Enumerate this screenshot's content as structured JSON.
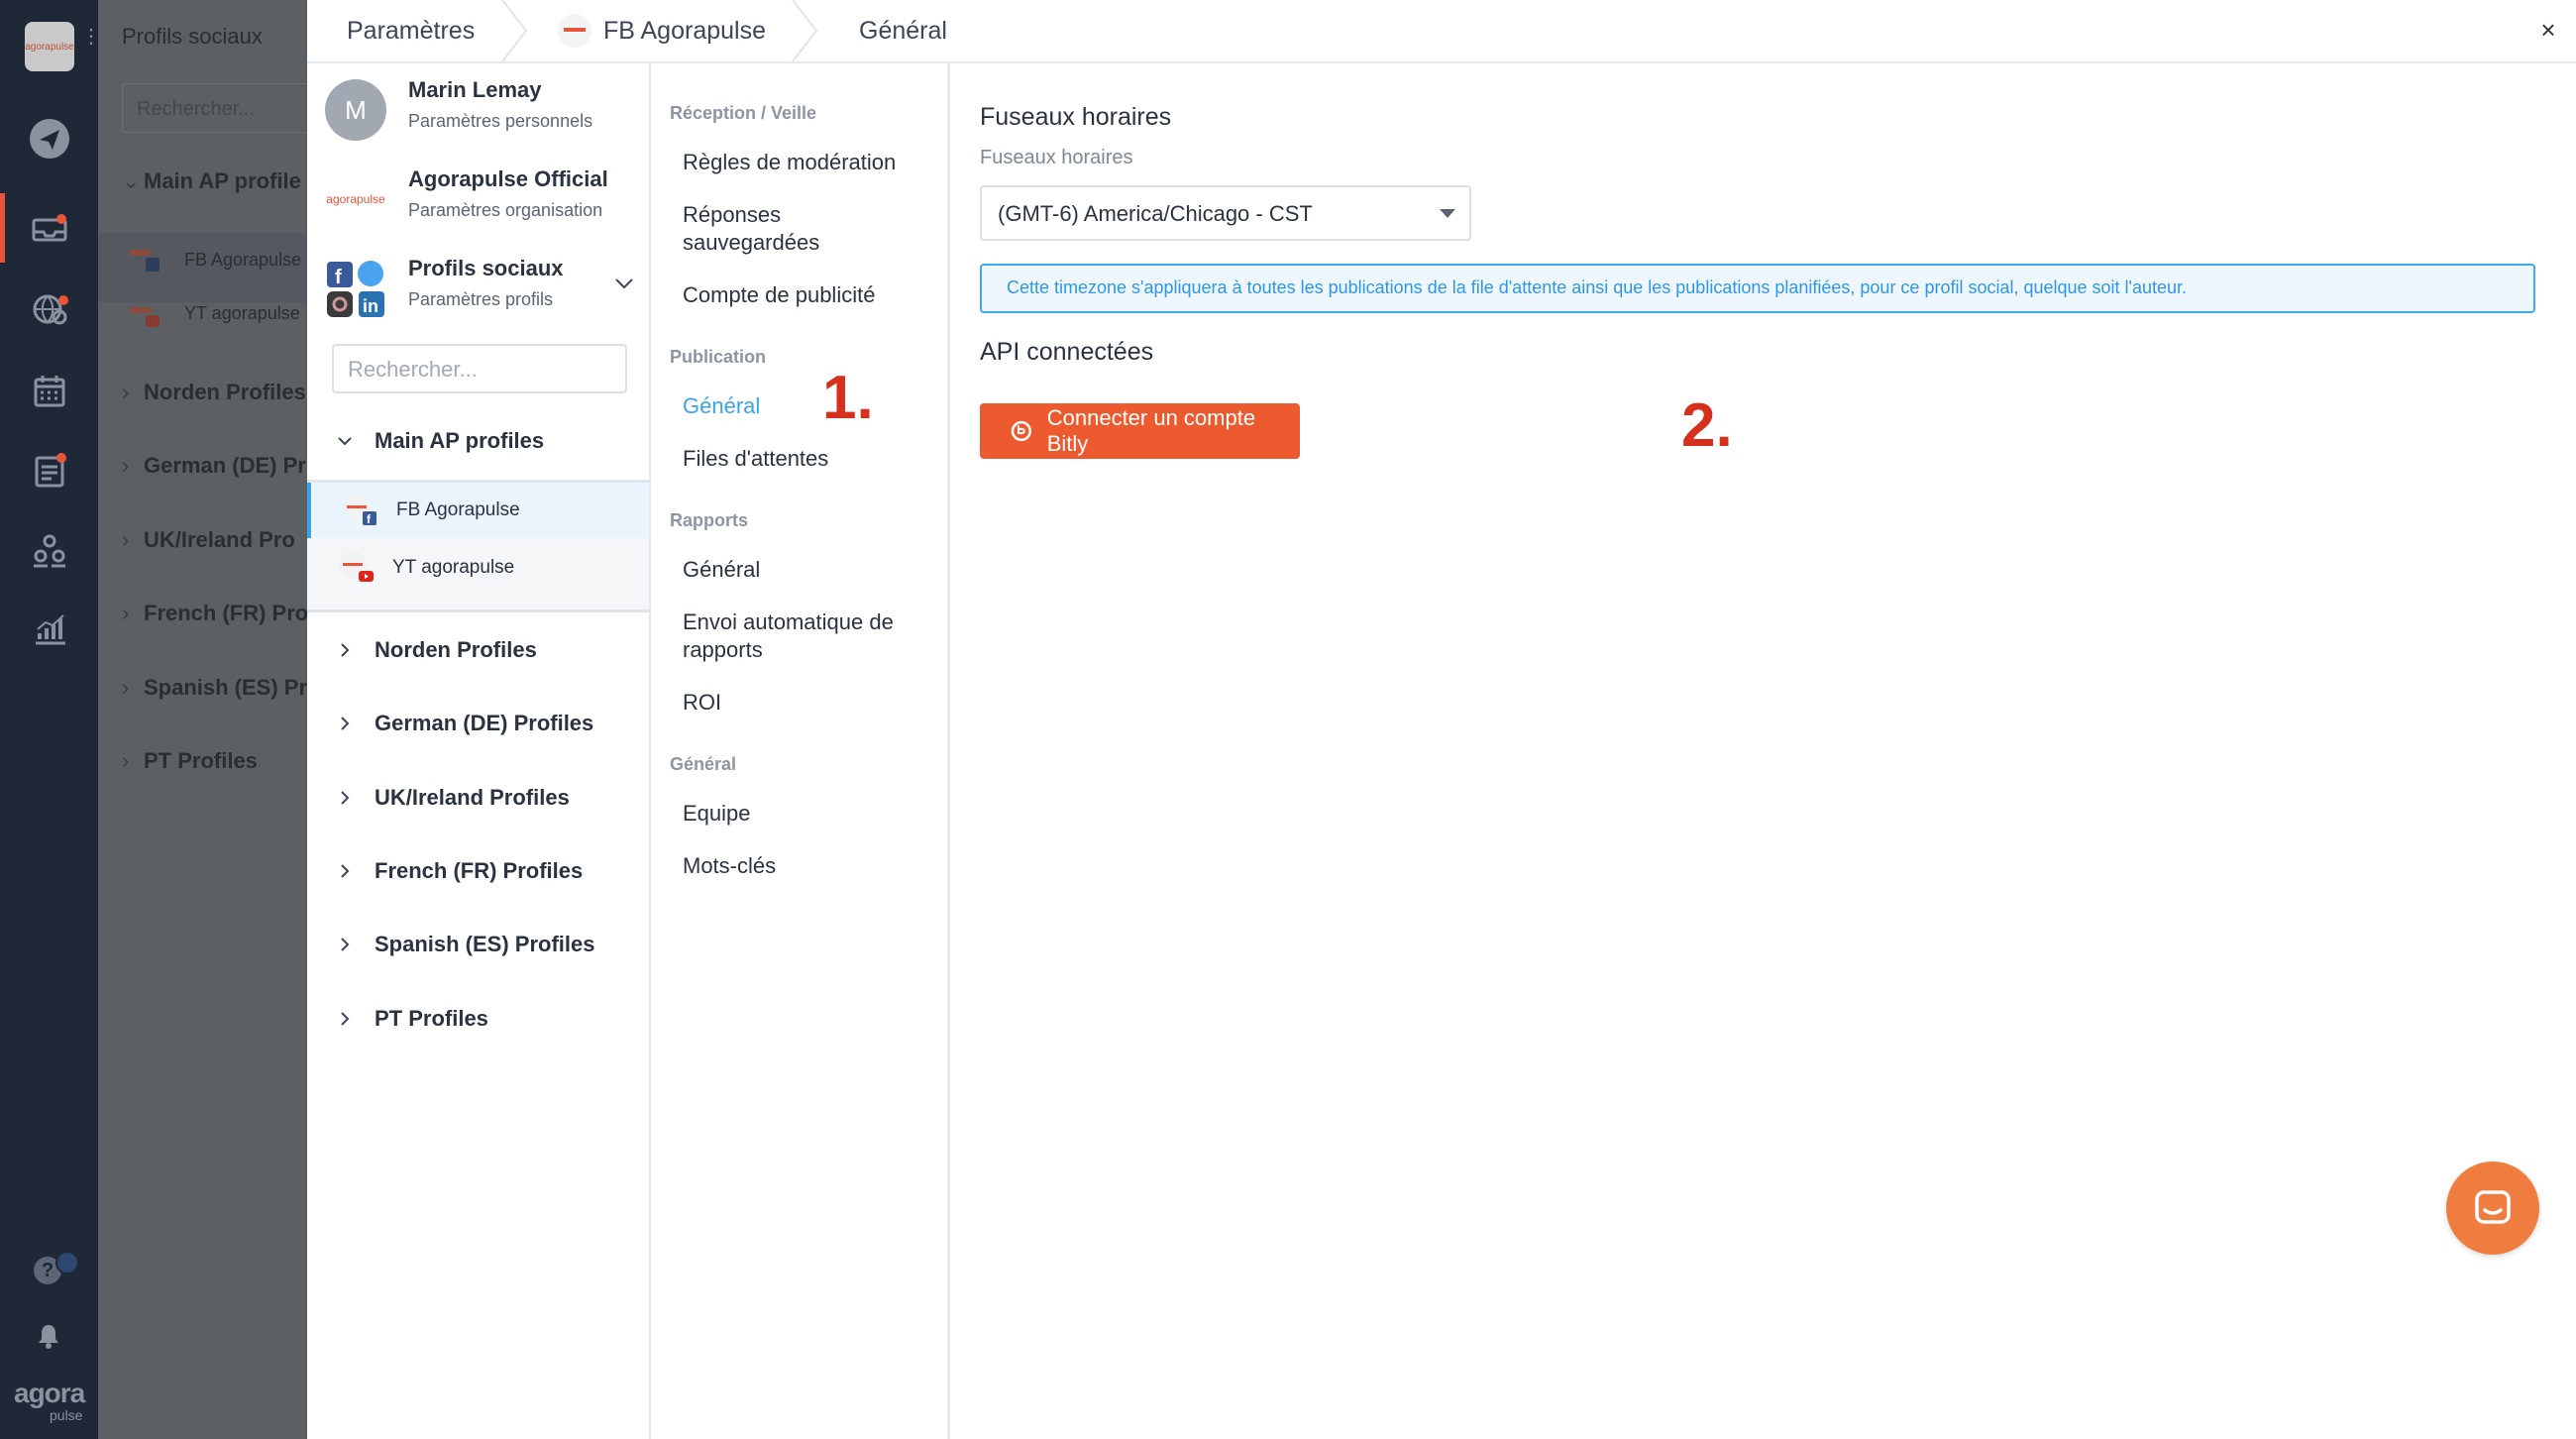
{
  "rail": {
    "logo_text": "agorapulse",
    "icons": [
      "send-icon",
      "inbox-icon",
      "listening-icon",
      "calendar-icon",
      "reports-icon",
      "team-icon",
      "analytics-icon"
    ],
    "brand": "agora",
    "brand_sub": "pulse"
  },
  "background_panel": {
    "title": "Profils sociaux",
    "search_placeholder": "Rechercher...",
    "groups": [
      "Main AP profile",
      "Norden Profiles",
      "German (DE) Pr",
      "UK/Ireland Pro",
      "French (FR) Pro",
      "Spanish (ES) Pr",
      "PT Profiles"
    ],
    "profiles": [
      "FB Agorapulse",
      "YT agorapulse"
    ]
  },
  "header": {
    "crumb1": "Paramètres",
    "crumb2": "FB Agorapulse",
    "crumb3": "Général",
    "close": "×"
  },
  "accounts": [
    {
      "initial": "M",
      "name": "Marin Lemay",
      "desc": "Paramètres personnels"
    },
    {
      "name": "Agorapulse Official",
      "desc": "Paramètres organisation",
      "logo": "agorapulse"
    },
    {
      "name": "Profils sociaux",
      "desc": "Paramètres profils"
    }
  ],
  "profile_search_placeholder": "Rechercher...",
  "tree": {
    "expanded_group": "Main AP profiles",
    "profiles": [
      "FB Agorapulse",
      "YT agorapulse"
    ],
    "groups": [
      "Norden Profiles",
      "German (DE) Profiles",
      "UK/Ireland Profiles",
      "French (FR) Profiles",
      "Spanish (ES) Profiles",
      "PT Profiles"
    ]
  },
  "settings_nav": {
    "sections": [
      {
        "title": "Réception / Veille",
        "items": [
          "Règles de modération",
          "Réponses sauvegardées",
          "Compte de publicité"
        ]
      },
      {
        "title": "Publication",
        "items": [
          "Général",
          "Files d'attentes"
        ]
      },
      {
        "title": "Rapports",
        "items": [
          "Général",
          "Envoi automatique de rapports",
          "ROI"
        ]
      },
      {
        "title": "Général",
        "items": [
          "Equipe",
          "Mots-clés"
        ]
      }
    ],
    "active": "Général"
  },
  "annotations": [
    "1.",
    "2."
  ],
  "content": {
    "timezone_heading": "Fuseaux horaires",
    "timezone_label": "Fuseaux horaires",
    "timezone_value": "(GMT-6) America/Chicago - CST",
    "timezone_info": "Cette timezone s'appliquera à toutes les publications de la file d'attente ainsi que les publications planifiées, pour ce profil social, quelque soit l'auteur.",
    "api_heading": "API connectées",
    "bitly_button": "Connecter un compte Bitly"
  },
  "colors": {
    "rail": "#1f2837",
    "accent_orange": "#ee5a2f",
    "link_blue": "#3ba3ec",
    "annotation_red": "#d62f1b"
  }
}
